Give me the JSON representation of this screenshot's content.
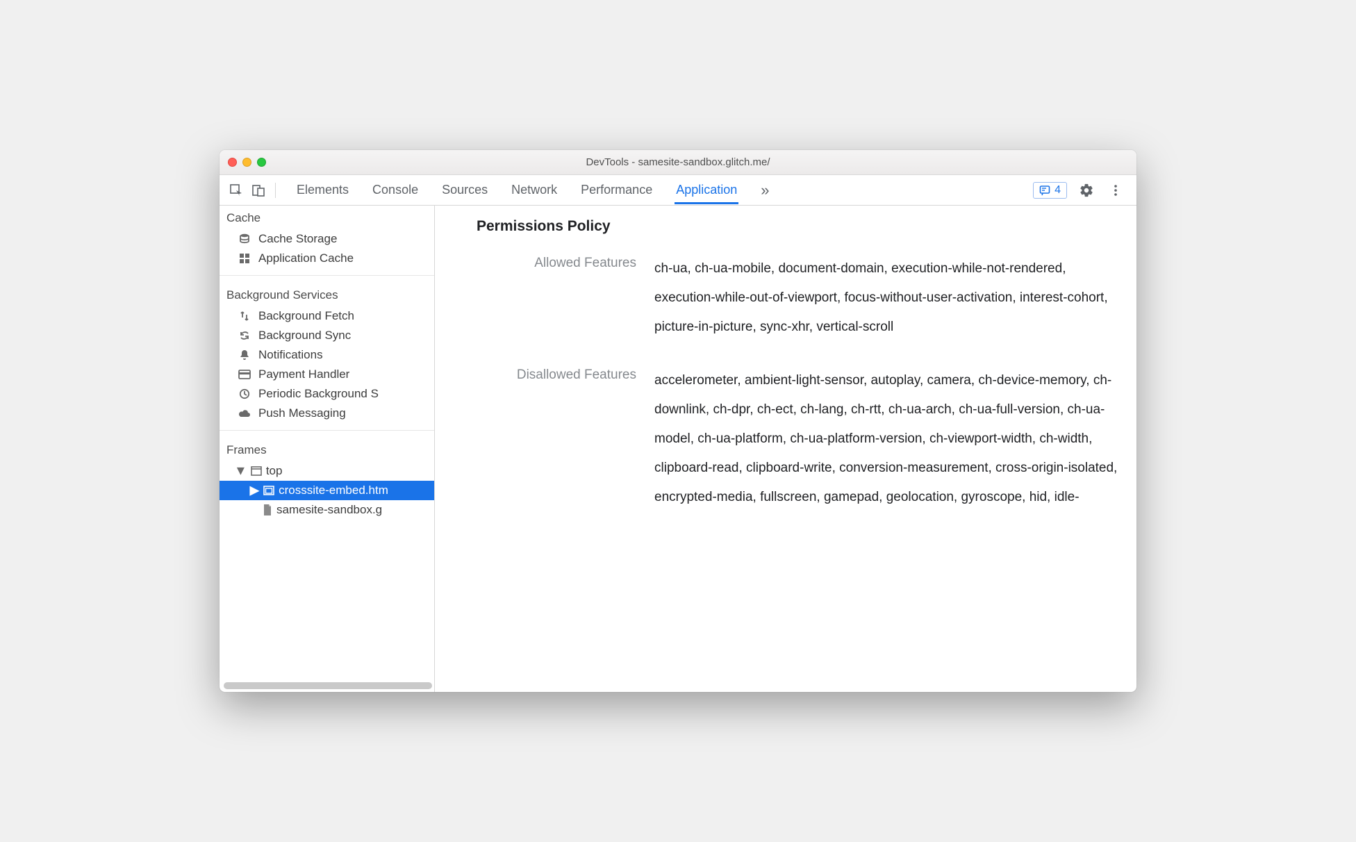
{
  "window": {
    "title": "DevTools - samesite-sandbox.glitch.me/"
  },
  "tabs": {
    "items": [
      {
        "label": "Elements"
      },
      {
        "label": "Console"
      },
      {
        "label": "Sources"
      },
      {
        "label": "Network"
      },
      {
        "label": "Performance"
      },
      {
        "label": "Application"
      }
    ],
    "active_index": 5,
    "overflow_glyph": "»"
  },
  "issues": {
    "count": "4"
  },
  "sidebar": {
    "cache": {
      "header": "Cache",
      "items": [
        {
          "label": "Cache Storage",
          "icon": "db-icon"
        },
        {
          "label": "Application Cache",
          "icon": "grid-icon"
        }
      ]
    },
    "bg": {
      "header": "Background Services",
      "items": [
        {
          "label": "Background Fetch",
          "icon": "fetch-icon"
        },
        {
          "label": "Background Sync",
          "icon": "sync-icon"
        },
        {
          "label": "Notifications",
          "icon": "bell-icon"
        },
        {
          "label": "Payment Handler",
          "icon": "card-icon"
        },
        {
          "label": "Periodic Background S",
          "icon": "clock-icon"
        },
        {
          "label": "Push Messaging",
          "icon": "cloud-icon"
        }
      ]
    },
    "frames": {
      "header": "Frames",
      "top": {
        "label": "top",
        "icon": "window-icon"
      },
      "child1": {
        "label": "crosssite-embed.htm",
        "icon": "iframe-icon"
      },
      "child2": {
        "label": "samesite-sandbox.g",
        "icon": "file-icon"
      }
    }
  },
  "main": {
    "section_title": "Permissions Policy",
    "rows": [
      {
        "label": "Allowed Features",
        "value": "ch-ua, ch-ua-mobile, document-domain, execution-while-not-rendered, execution-while-out-of-viewport, focus-without-user-activation, interest-cohort, picture-in-picture, sync-xhr, vertical-scroll"
      },
      {
        "label": "Disallowed Features",
        "value": "accelerometer, ambient-light-sensor, autoplay, camera, ch-device-memory, ch-downlink, ch-dpr, ch-ect, ch-lang, ch-rtt, ch-ua-arch, ch-ua-full-version, ch-ua-model, ch-ua-platform, ch-ua-platform-version, ch-viewport-width, ch-width, clipboard-read, clipboard-write, conversion-measurement, cross-origin-isolated, encrypted-media, fullscreen, gamepad, geolocation, gyroscope, hid, idle-"
      }
    ]
  }
}
